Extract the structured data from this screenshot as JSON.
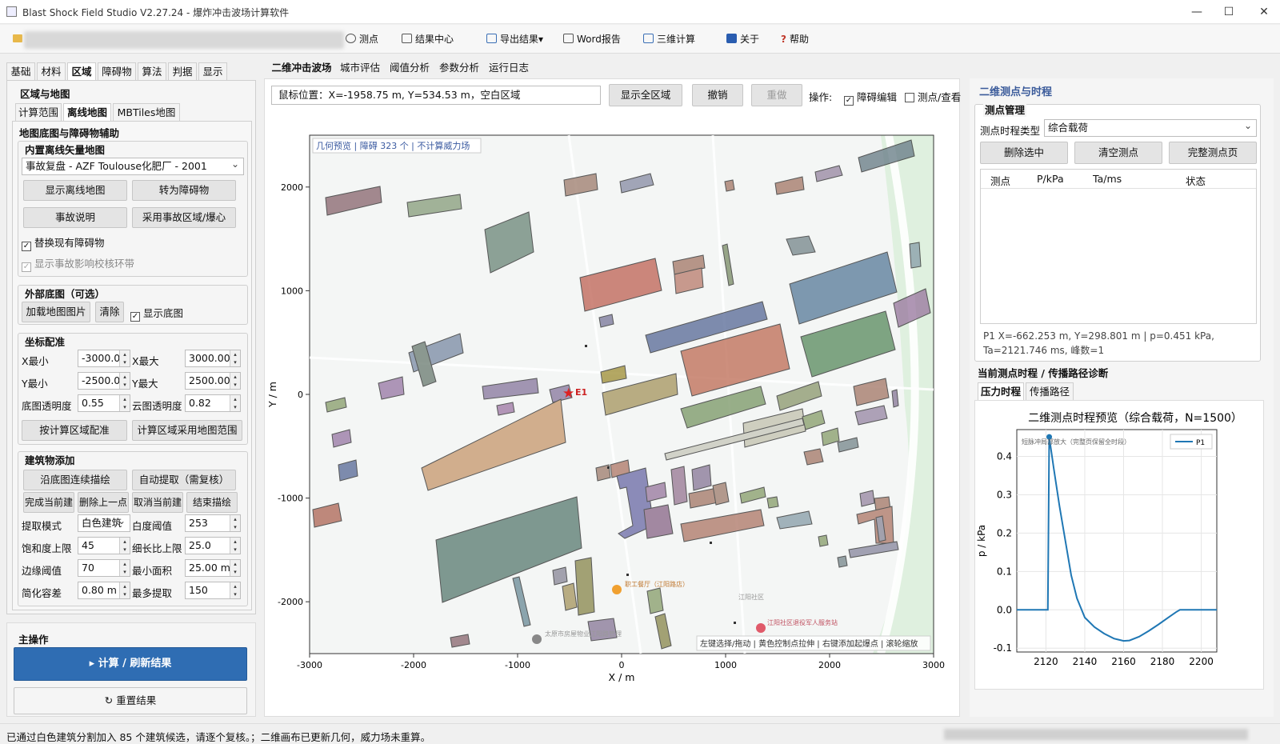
{
  "window": {
    "title": "Blast Shock Field Studio V2.27.24 - 爆炸冲击波场计算软件"
  },
  "toolbar": {
    "items": [
      "测点",
      "结果中心",
      "导出结果",
      "Word报告",
      "三维计算",
      "关于",
      "帮助"
    ]
  },
  "left": {
    "tabs": [
      "基础",
      "材料",
      "区域",
      "障碍物",
      "算法",
      "判据",
      "显示"
    ],
    "section_title": "区域与地图",
    "subtabs": [
      "计算范围",
      "离线地图",
      "MBTiles地图"
    ],
    "map_group_title": "地图底图与障碍物辅助",
    "offline": {
      "title": "内置离线矢量地图",
      "selected": "事故复盘 - AZF Toulouse化肥厂 - 2001",
      "btn_show": "显示离线地图",
      "btn_convert": "转为障碍物",
      "btn_desc": "事故说明",
      "btn_use": "采用事故区域/爆心",
      "chk_replace": "替换现有障碍物",
      "chk_ring": "显示事故影响校核环带"
    },
    "external": {
      "title": "外部底图（可选）",
      "btn_load": "加载地图图片",
      "btn_clear": "清除",
      "chk_show": "显示底图"
    },
    "coords": {
      "title": "坐标配准",
      "xmin_label": "X最小",
      "xmin": "-3000.00",
      "xmax_label": "X最大",
      "xmax": "3000.00",
      "ymin_label": "Y最小",
      "ymin": "-2500.00",
      "ymax_label": "Y最大",
      "ymax": "2500.00",
      "base_alpha_label": "底图透明度",
      "base_alpha": "0.55",
      "cloud_alpha_label": "云图透明度",
      "cloud_alpha": "0.82",
      "btn_fit": "按计算区域配准",
      "btn_use_map": "计算区域采用地图范围"
    },
    "building": {
      "title": "建筑物添加",
      "btn_trace": "沿底图连续描绘",
      "btn_auto": "自动提取（需复核）",
      "btn_finish": "完成当前建",
      "btn_delete_last": "删除上一点",
      "btn_cancel": "取消当前建",
      "btn_end": "结束描绘",
      "mode_label": "提取模式",
      "mode": "白色建筑",
      "white_label": "白度阈值",
      "white": "253",
      "sat_label": "饱和度上限",
      "sat": "45",
      "ratio_label": "细长比上限",
      "ratio": "25.0",
      "edge_label": "边缘阈值",
      "edge": "70",
      "area_label": "最小面积",
      "area": "25.00 m²",
      "simp_label": "简化容差",
      "simp": "0.80 m",
      "max_label": "最多提取",
      "max": "150"
    },
    "main_ops": {
      "title": "主操作",
      "btn_compute": "▸  计算 / 刷新结果",
      "btn_reset": "↻  重置结果"
    }
  },
  "center": {
    "tabs": [
      "二维冲击波场",
      "城市评估",
      "阈值分析",
      "参数分析",
      "运行日志"
    ],
    "mouse_pos": "鼠标位置：X=-1958.75 m, Y=534.53 m，空白区域",
    "btn_full": "显示全区域",
    "btn_undo": "撤销",
    "btn_redo": "重做",
    "op_label": "操作:",
    "chk_edit": "障碍编辑",
    "chk_probe": "测点/查看",
    "map_info": "几何预览 | 障碍 323 个 | 不计算威力场",
    "map_hint": "左键选择/拖动 | 黄色控制点拉伸 | 右键添加起爆点 | 滚轮缩放",
    "explosion_label": "E1",
    "xlabel": "X / m",
    "ylabel": "Y / m",
    "xticks": [
      "-3000",
      "-2000",
      "-1000",
      "0",
      "1000",
      "2000",
      "3000"
    ],
    "yticks": [
      "2000",
      "1000",
      "0",
      "-1000",
      "-2000"
    ],
    "poi": [
      "职工餐厅（江阳路店）",
      "江阳社区",
      "江阳社区退役军人服务站",
      "太原市房屋物业江阳路管理"
    ]
  },
  "right": {
    "title": "二维测点与时程",
    "mgmt_title": "测点管理",
    "type_label": "测点时程类型",
    "type": "综合载荷",
    "btn_delete": "删除选中",
    "btn_clear": "清空测点",
    "btn_page": "完整测点页",
    "cols": [
      "测点",
      "P/kPa",
      "Ta/ms",
      "状态"
    ],
    "info": "P1  X=-662.253 m, Y=298.801 m  |  p=0.451 kPa, Ta=2121.746 ms, 峰数=1",
    "history_title": "当前测点时程 / 传播路径诊断",
    "subtabs": [
      "压力时程",
      "传播路径"
    ]
  },
  "chart_data": {
    "type": "line",
    "title": "二维测点时程预览（综合载荷，N=1500）",
    "annotation": "短脉冲局部放大（完整页保留全时段）",
    "xlabel": "",
    "ylabel": "p / kPa",
    "xlim": [
      2105,
      2208
    ],
    "ylim": [
      -0.11,
      0.47
    ],
    "xticks": [
      2120,
      2140,
      2160,
      2180,
      2200
    ],
    "yticks": [
      -0.1,
      0.0,
      0.1,
      0.2,
      0.3,
      0.4
    ],
    "series": [
      {
        "name": "P1",
        "color": "#1f77b4",
        "x": [
          2105,
          2121,
          2121.7,
          2124,
          2127,
          2130,
          2133,
          2136,
          2140,
          2145,
          2150,
          2155,
          2160,
          2163,
          2168,
          2173,
          2178,
          2183,
          2187,
          2189,
          2208
        ],
        "y": [
          0,
          0,
          0.451,
          0.37,
          0.27,
          0.18,
          0.09,
          0.03,
          -0.02,
          -0.045,
          -0.062,
          -0.075,
          -0.081,
          -0.08,
          -0.07,
          -0.055,
          -0.038,
          -0.02,
          -0.006,
          0,
          0
        ]
      }
    ],
    "peak_marker": {
      "x": 2121.7,
      "y": 0.451
    },
    "legend": "top-right"
  },
  "status": {
    "text": "已通过白色建筑分割加入 85 个建筑候选，请逐个复核。；二维画布已更新几何，威力场未重算。"
  }
}
